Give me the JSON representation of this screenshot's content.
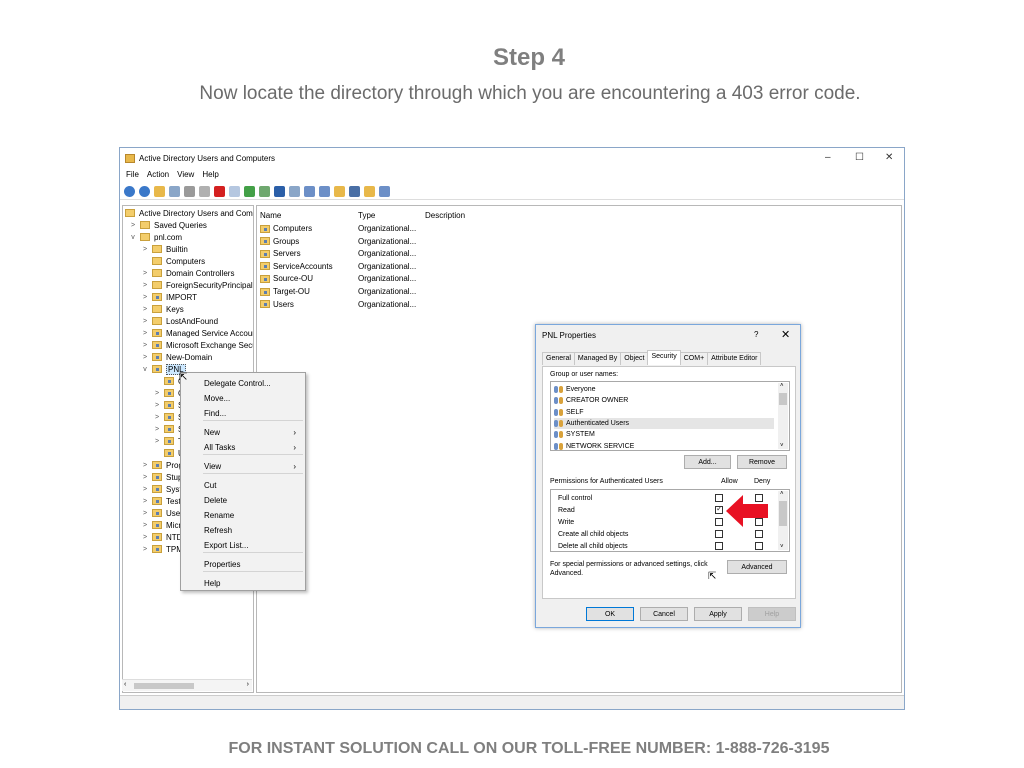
{
  "slide": {
    "title": "Step 4",
    "subtitle": "Now locate the directory through which you are encountering a 403 error code.",
    "footer": "FOR INSTANT SOLUTION CALL ON OUR TOLL-FREE NUMBER: 1-888-726-3195"
  },
  "window": {
    "title": "Active Directory Users and Computers",
    "controls": {
      "minimize": "–",
      "maximize": "☐",
      "close": "✕"
    },
    "menu": [
      "File",
      "Action",
      "View",
      "Help"
    ]
  },
  "tree": {
    "root": "Active Directory Users and Com",
    "items": [
      {
        "label": "Saved Queries",
        "exp": ">"
      },
      {
        "label": "pnl.com",
        "exp": "v"
      },
      {
        "label": "Builtin",
        "exp": ">"
      },
      {
        "label": "Computers",
        "exp": ""
      },
      {
        "label": "Domain Controllers",
        "exp": ">"
      },
      {
        "label": "ForeignSecurityPrincipals",
        "exp": ">"
      },
      {
        "label": "IMPORT",
        "exp": ">"
      },
      {
        "label": "Keys",
        "exp": ">"
      },
      {
        "label": "LostAndFound",
        "exp": ">"
      },
      {
        "label": "Managed Service Accour",
        "exp": ">"
      },
      {
        "label": "Microsoft Exchange Secu",
        "exp": ">"
      },
      {
        "label": "New-Domain",
        "exp": ">"
      },
      {
        "label": "PNL",
        "exp": "v"
      },
      {
        "label": "C",
        "exp": ""
      },
      {
        "label": "C",
        "exp": ">"
      },
      {
        "label": "S",
        "exp": ">"
      },
      {
        "label": "S",
        "exp": ">"
      },
      {
        "label": "S",
        "exp": ">"
      },
      {
        "label": "T",
        "exp": ">"
      },
      {
        "label": "U",
        "exp": ""
      },
      {
        "label": "Prog",
        "exp": ">"
      },
      {
        "label": "Stup",
        "exp": ">"
      },
      {
        "label": "Syst",
        "exp": ">"
      },
      {
        "label": "Test",
        "exp": ">"
      },
      {
        "label": "User",
        "exp": ">"
      },
      {
        "label": "Micr",
        "exp": ">"
      },
      {
        "label": "NTD",
        "exp": ">"
      },
      {
        "label": "TPM",
        "exp": ">"
      }
    ]
  },
  "list": {
    "headers": {
      "name": "Name",
      "type": "Type",
      "description": "Description"
    },
    "rows": [
      {
        "name": "Computers",
        "type": "Organizational..."
      },
      {
        "name": "Groups",
        "type": "Organizational..."
      },
      {
        "name": "Servers",
        "type": "Organizational..."
      },
      {
        "name": "ServiceAccounts",
        "type": "Organizational..."
      },
      {
        "name": "Source-OU",
        "type": "Organizational..."
      },
      {
        "name": "Target-OU",
        "type": "Organizational..."
      },
      {
        "name": "Users",
        "type": "Organizational..."
      }
    ]
  },
  "context_menu": {
    "items": [
      {
        "label": "Delegate Control...",
        "arrow": ""
      },
      {
        "label": "Move...",
        "arrow": ""
      },
      {
        "label": "Find...",
        "arrow": ""
      },
      {
        "label": "New",
        "arrow": "›"
      },
      {
        "label": "All Tasks",
        "arrow": "›"
      },
      {
        "label": "View",
        "arrow": "›"
      },
      {
        "label": "Cut",
        "arrow": ""
      },
      {
        "label": "Delete",
        "arrow": ""
      },
      {
        "label": "Rename",
        "arrow": ""
      },
      {
        "label": "Refresh",
        "arrow": ""
      },
      {
        "label": "Export List...",
        "arrow": ""
      },
      {
        "label": "Properties",
        "arrow": ""
      },
      {
        "label": "Help",
        "arrow": ""
      }
    ]
  },
  "dialog": {
    "title": "PNL Properties",
    "help": "?",
    "close": "✕",
    "tabs": [
      "General",
      "Managed By",
      "Object",
      "Security",
      "COM+",
      "Attribute Editor"
    ],
    "active_tab": "Security",
    "group_label": "Group or user names:",
    "groups": [
      "Everyone",
      "CREATOR OWNER",
      "SELF",
      "Authenticated Users",
      "SYSTEM",
      "NETWORK SERVICE"
    ],
    "add_button": "Add...",
    "remove_button": "Remove",
    "perm_label": "Permissions for Authenticated Users",
    "allow_label": "Allow",
    "deny_label": "Deny",
    "permissions": [
      {
        "name": "Full control",
        "allow": false,
        "deny": false
      },
      {
        "name": "Read",
        "allow": true,
        "deny": false
      },
      {
        "name": "Write",
        "allow": false,
        "deny": false
      },
      {
        "name": "Create all child objects",
        "allow": false,
        "deny": false
      },
      {
        "name": "Delete all child objects",
        "allow": false,
        "deny": false
      }
    ],
    "special_text": "For special permissions or advanced settings, click Advanced.",
    "advanced_button": "Advanced",
    "ok": "OK",
    "cancel": "Cancel",
    "apply": "Apply",
    "help_button": "Help"
  },
  "colors": {
    "highlight_arrow": "#e81123",
    "accent": "#0078d7"
  }
}
